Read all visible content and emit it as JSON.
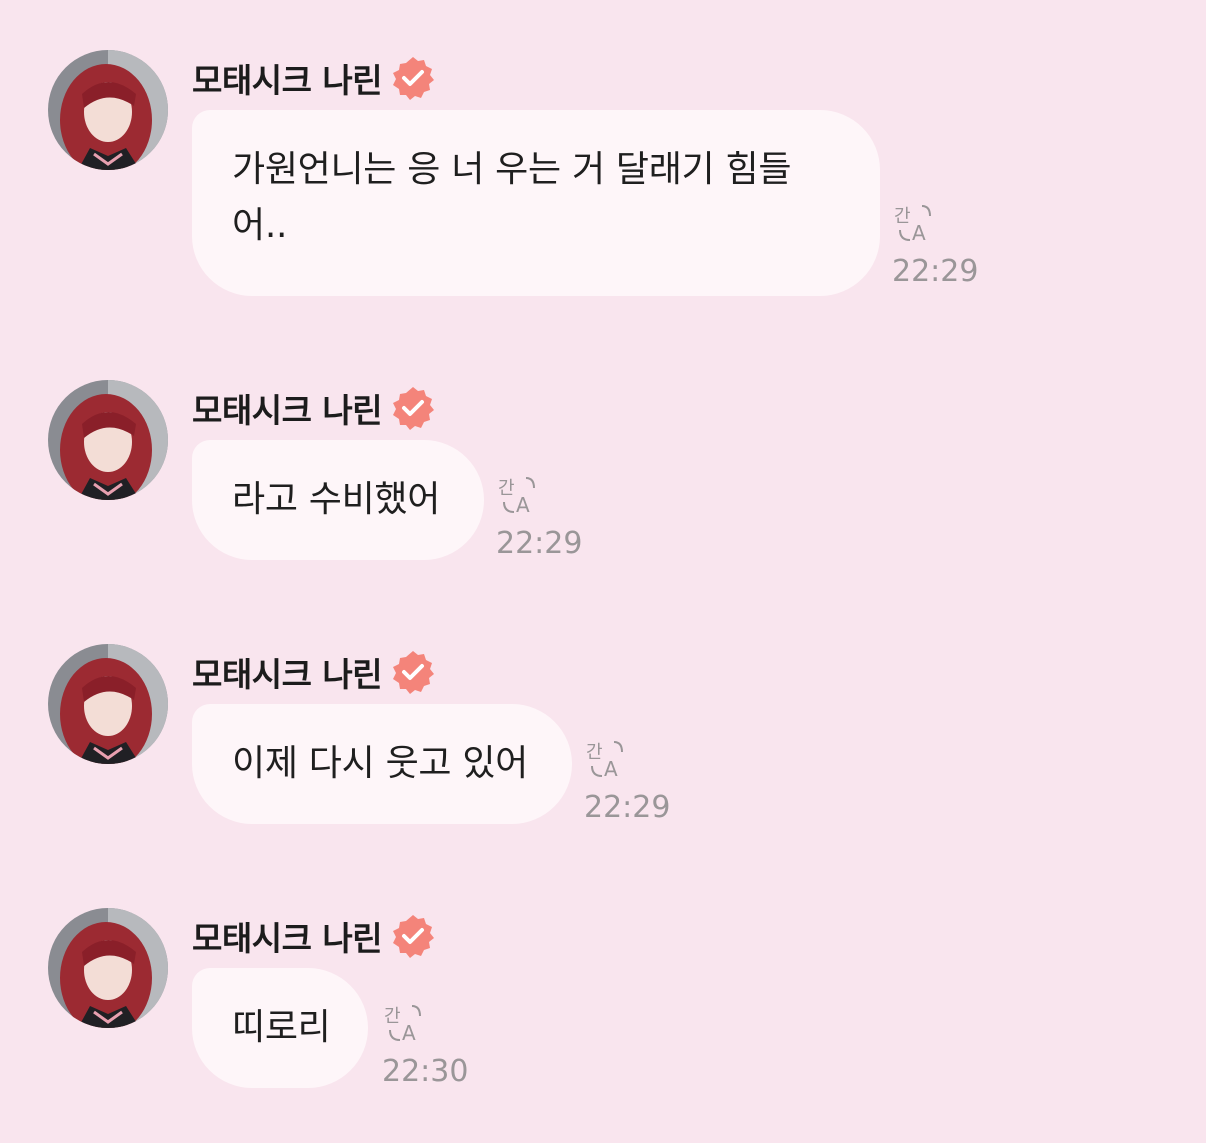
{
  "messages": [
    {
      "sender": "모태시크 나린",
      "verified": true,
      "text_lines": [
        "가원언니는 응 너 우는 거 달래기 힘들",
        "어.."
      ],
      "time": "22:29",
      "translate_icon": "translate-icon"
    },
    {
      "sender": "모태시크 나린",
      "verified": true,
      "text": "라고 수비했어",
      "time": "22:29",
      "translate_icon": "translate-icon"
    },
    {
      "sender": "모태시크 나린",
      "verified": true,
      "text": "이제 다시 웃고 있어",
      "time": "22:29",
      "translate_icon": "translate-icon"
    },
    {
      "sender": "모태시크 나린",
      "verified": true,
      "text": "띠로리",
      "time": "22:30",
      "translate_icon": "translate-icon"
    }
  ],
  "colors": {
    "background": "#f9e5ee",
    "bubble": "#fef6f9",
    "verified_badge": "#f4847a",
    "timestamp": "#9a9698"
  }
}
